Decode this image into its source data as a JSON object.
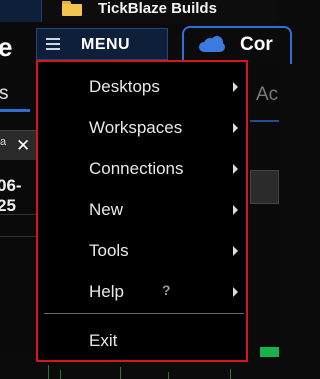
{
  "window": {
    "title": "TickBlaze Builds"
  },
  "background": {
    "app_letter": "e",
    "left_tab": "s",
    "small_label": "a",
    "date_fragment": "06-25",
    "close_symbol": "✕",
    "right_tab_fragment": "Ac"
  },
  "menu_button": {
    "label": "MENU"
  },
  "connection_tab": {
    "label": "Cor"
  },
  "dropdown": {
    "items": [
      {
        "label": "Desktops",
        "submenu": true
      },
      {
        "label": "Workspaces",
        "submenu": true
      },
      {
        "label": "Connections",
        "submenu": true
      },
      {
        "label": "New",
        "submenu": true
      },
      {
        "label": "Tools",
        "submenu": true
      },
      {
        "label": "Help",
        "submenu": true,
        "badge": "?"
      }
    ],
    "exit_label": "Exit"
  },
  "colors": {
    "menu_border": "#d9141c",
    "accent_blue": "#2f6fd6",
    "menu_button_bg": "#0e1f3a",
    "folder_yellow": "#f4c44e"
  },
  "icons": [
    "folder-icon",
    "hamburger-icon",
    "cloud-icon",
    "chevron-right-icon",
    "help-icon",
    "close-icon"
  ]
}
